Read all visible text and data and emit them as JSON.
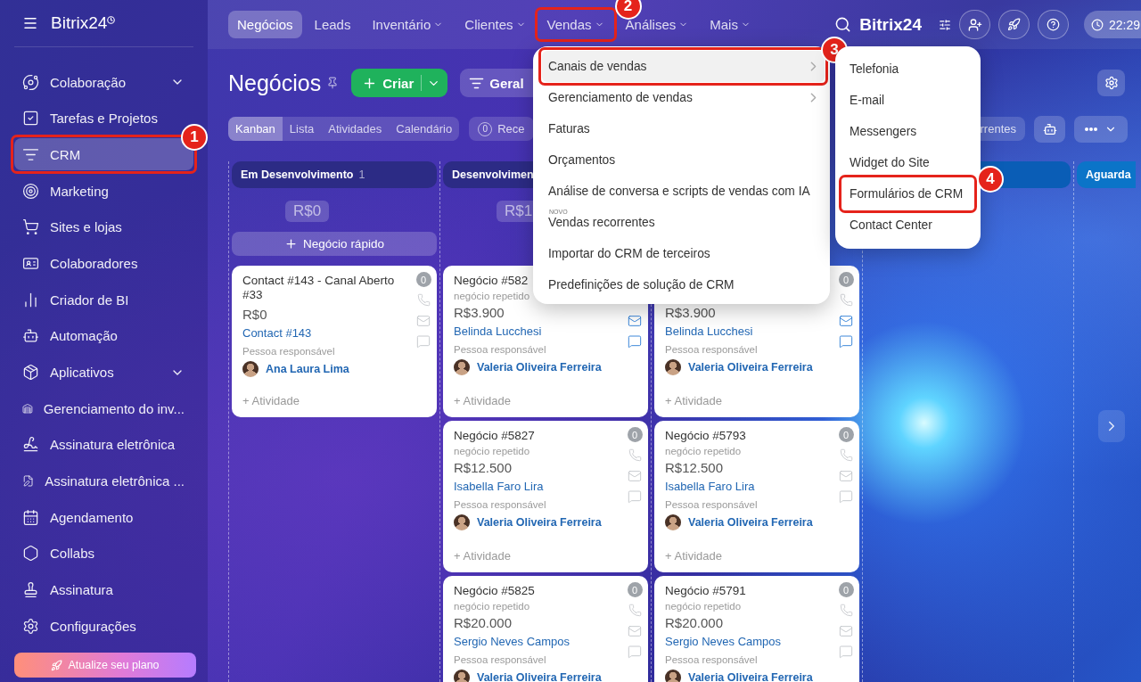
{
  "sidebar": {
    "logo": "Bitrix24",
    "items": [
      {
        "label": "Colaboração",
        "selected": false,
        "expanded": false
      },
      {
        "label": "Tarefas e Projetos",
        "selected": false
      },
      {
        "label": "CRM",
        "selected": true,
        "callout": "1"
      },
      {
        "label": "Marketing",
        "selected": false
      },
      {
        "label": "Sites e lojas",
        "selected": false
      },
      {
        "label": "Colaboradores",
        "selected": false
      },
      {
        "label": "Criador de BI",
        "selected": false
      },
      {
        "label": "Automação",
        "selected": false
      },
      {
        "label": "Aplicativos",
        "selected": false,
        "expanded": false
      },
      {
        "label": "Gerenciamento do inv...",
        "selected": false
      },
      {
        "label": "Assinatura eletrônica",
        "selected": false
      },
      {
        "label": "Assinatura eletrônica ...",
        "selected": false
      },
      {
        "label": "Agendamento",
        "selected": false
      },
      {
        "label": "Collabs",
        "selected": false
      },
      {
        "label": "Assinatura",
        "selected": false
      },
      {
        "label": "Configurações",
        "selected": false
      }
    ],
    "upgrade_button": "Atualize seu plano"
  },
  "top_nav": [
    {
      "label": "Negócios",
      "selected": true,
      "has_menu": false
    },
    {
      "label": "Leads",
      "selected": false,
      "has_menu": false
    },
    {
      "label": "Inventário",
      "selected": false,
      "has_menu": true
    },
    {
      "label": "Clientes",
      "selected": false,
      "has_menu": true
    },
    {
      "label": "Vendas",
      "selected": false,
      "has_menu": true,
      "callout": "2"
    },
    {
      "label": "Análises",
      "selected": false,
      "has_menu": true
    },
    {
      "label": "Mais",
      "selected": false,
      "has_menu": true
    }
  ],
  "header_right": {
    "brand": "Bitrix24",
    "clock": "22:29"
  },
  "toolbar": {
    "title": "Negócios",
    "create_button": "Criar",
    "filter_button": "Geral"
  },
  "view_tabs": [
    {
      "label": "Kanban",
      "selected": true
    },
    {
      "label": "Lista",
      "selected": false
    },
    {
      "label": "Atividades",
      "selected": false
    },
    {
      "label": "Calendário",
      "selected": false
    }
  ],
  "counter_chip": {
    "count": "0",
    "label": "Rece"
  },
  "recurring_chip": "rrentes",
  "columns": [
    {
      "title": "Em Desenvolvimento",
      "count": "1",
      "color": "#2c2b85",
      "sum": "R$0",
      "quick_add": "Negócio rápido",
      "cards": [
        {
          "title": "Contact #143 - Canal Aberto #33",
          "amount": "R$0",
          "contact": "Contact #143",
          "responsible_label": "Pessoa responsável",
          "responsible": "Ana Laura Lima",
          "activity": "+ Atividade",
          "icons": [
            {
              "kind": "counter",
              "text": "0",
              "active": false
            },
            {
              "kind": "phone",
              "active": false
            },
            {
              "kind": "mail",
              "active": false
            },
            {
              "kind": "chat",
              "active": false
            }
          ]
        }
      ]
    },
    {
      "title": "Desenvolvimen",
      "color": "#2c2b85",
      "sum": "R$1",
      "cards": [
        {
          "title": "Negócio #582",
          "subtitle": "negócio repetido",
          "amount": "R$3.900",
          "contact": "Belinda Lucchesi",
          "responsible_label": "Pessoa responsável",
          "responsible": "Valeria Oliveira Ferreira",
          "activity": "+ Atividade",
          "icons": [
            {
              "kind": "mail",
              "active": true
            },
            {
              "kind": "chat",
              "active": true
            }
          ]
        },
        {
          "title": "Negócio #5827",
          "subtitle": "negócio repetido",
          "amount": "R$12.500",
          "contact": "Isabella Faro Lira",
          "responsible_label": "Pessoa responsável",
          "responsible": "Valeria Oliveira Ferreira",
          "activity": "+ Atividade",
          "icons": [
            {
              "kind": "counter",
              "text": "0",
              "active": false
            },
            {
              "kind": "phone",
              "active": false
            },
            {
              "kind": "mail",
              "active": false
            },
            {
              "kind": "chat",
              "active": false
            }
          ]
        },
        {
          "title": "Negócio #5825",
          "subtitle": "negócio repetido",
          "amount": "R$20.000",
          "contact": "Sergio Neves Campos",
          "responsible_label": "Pessoa responsável",
          "responsible": "Valeria Oliveira Ferreira",
          "icons": [
            {
              "kind": "counter",
              "text": "0",
              "active": false
            },
            {
              "kind": "phone",
              "active": false
            },
            {
              "kind": "mail",
              "active": false
            },
            {
              "kind": "chat",
              "active": false
            }
          ]
        }
      ]
    },
    {
      "cards": [
        {
          "amount": "R$3.900",
          "contact": "Belinda Lucchesi",
          "responsible_label": "Pessoa responsável",
          "responsible": "Valeria Oliveira Ferreira",
          "activity": "+ Atividade",
          "icons": [
            {
              "kind": "counter",
              "text": "0",
              "active": false
            },
            {
              "kind": "phone",
              "active": false
            },
            {
              "kind": "mail",
              "active": true
            },
            {
              "kind": "chat",
              "active": true
            }
          ]
        },
        {
          "title": "Negócio #5793",
          "subtitle": "negócio repetido",
          "amount": "R$12.500",
          "contact": "Isabella Faro Lira",
          "responsible_label": "Pessoa responsável",
          "responsible": "Valeria Oliveira Ferreira",
          "activity": "+ Atividade",
          "icons": [
            {
              "kind": "counter",
              "text": "0",
              "active": false
            },
            {
              "kind": "phone",
              "active": false
            },
            {
              "kind": "mail",
              "active": false
            },
            {
              "kind": "chat",
              "active": false
            }
          ]
        },
        {
          "title": "Negócio #5791",
          "subtitle": "negócio repetido",
          "amount": "R$20.000",
          "contact": "Sergio Neves Campos",
          "responsible_label": "Pessoa responsável",
          "responsible": "Valeria Oliveira Ferreira",
          "icons": [
            {
              "kind": "counter",
              "text": "0",
              "active": false
            },
            {
              "kind": "phone",
              "active": false
            },
            {
              "kind": "mail",
              "active": false
            },
            {
              "kind": "chat",
              "active": false
            }
          ]
        }
      ]
    },
    {
      "color": "#0a5db6"
    },
    {
      "title": "Aguarda",
      "color": "#0b74c8"
    }
  ],
  "vendas_menu": [
    {
      "label": "Canais de vendas",
      "selected": true,
      "has_submenu": true,
      "callout": "3"
    },
    {
      "label": "Gerenciamento de vendas",
      "selected": false,
      "has_submenu": true
    },
    {
      "label": "Faturas",
      "selected": false,
      "has_submenu": false
    },
    {
      "label": "Orçamentos",
      "selected": false,
      "has_submenu": false
    },
    {
      "label": "Análise de conversa e scripts de vendas com IA",
      "selected": false,
      "has_submenu": false
    },
    {
      "label": "Vendas recorrentes",
      "badge": "NOVO",
      "selected": false,
      "has_submenu": false
    },
    {
      "label": "Importar do CRM de terceiros",
      "selected": false,
      "has_submenu": false
    },
    {
      "label": "Predefinições de solução de CRM",
      "selected": false,
      "has_submenu": false
    }
  ],
  "channels_submenu": [
    {
      "label": "Telefonia"
    },
    {
      "label": "E-mail"
    },
    {
      "label": "Messengers"
    },
    {
      "label": "Widget do Site"
    },
    {
      "label": "Formulários de CRM",
      "callout": "4"
    },
    {
      "label": "Contact Center"
    }
  ]
}
